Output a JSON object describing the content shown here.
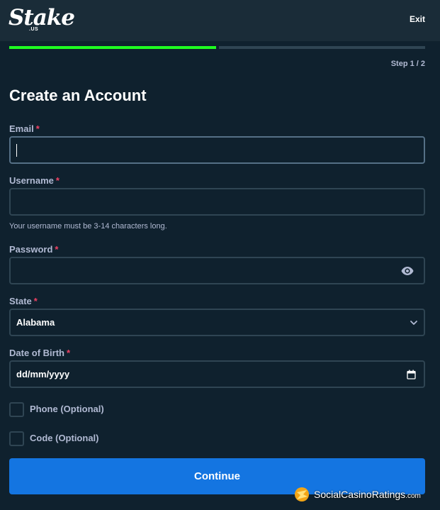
{
  "header": {
    "logo_text": "Stake",
    "logo_sub": ".US",
    "exit_label": "Exit"
  },
  "progress": {
    "step_text": "Step 1 / 2",
    "current_step": 1,
    "total_steps": 2
  },
  "form": {
    "title": "Create an Account",
    "required_mark": "*",
    "email": {
      "label": "Email",
      "value": ""
    },
    "username": {
      "label": "Username",
      "value": "",
      "hint": "Your username must be 3-14 characters long."
    },
    "password": {
      "label": "Password",
      "value": ""
    },
    "state": {
      "label": "State",
      "selected": "Alabama"
    },
    "dob": {
      "label": "Date of Birth",
      "placeholder": "dd/mm/yyyy"
    },
    "phone": {
      "label": "Phone (Optional)",
      "checked": false
    },
    "code": {
      "label": "Code (Optional)",
      "checked": false
    },
    "continue_label": "Continue"
  },
  "watermark": {
    "text": "SocialCasinoRatings",
    "suffix": ".com"
  },
  "colors": {
    "background": "#0f212e",
    "header": "#1a2c38",
    "progress_active": "#1fff20",
    "progress_inactive": "#2f4553",
    "input_border": "#2f4553",
    "label": "#b1bad3",
    "required": "#ed4163",
    "primary_button": "#1475e1"
  }
}
